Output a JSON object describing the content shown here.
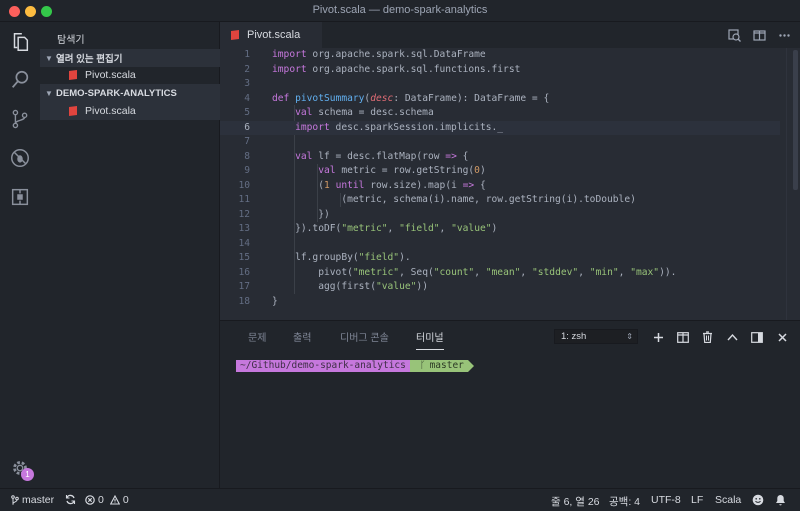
{
  "window": {
    "title": "Pivot.scala — demo-spark-analytics"
  },
  "activity": {
    "badge": "1"
  },
  "sidebar": {
    "title": "탐색기",
    "open_editors_label": "열려 있는 편집기",
    "open_file": "Pivot.scala",
    "project_label": "DEMO-SPARK-ANALYTICS",
    "project_file": "Pivot.scala"
  },
  "tab": {
    "label": "Pivot.scala"
  },
  "code": {
    "line_numbers": [
      "1",
      "2",
      "3",
      "4",
      "5",
      "6",
      "7",
      "8",
      "9",
      "10",
      "11",
      "12",
      "13",
      "14",
      "15",
      "16",
      "17",
      "18"
    ],
    "l1": [
      "import",
      " org.apache.spark.sql.DataFrame"
    ],
    "l2": [
      "import",
      " org.apache.spark.sql.functions.first"
    ],
    "l4": [
      "def",
      " ",
      "pivotSummary",
      "(",
      "desc",
      ": DataFrame): DataFrame = {"
    ],
    "l5": [
      "val",
      " schema = desc.schema"
    ],
    "l6": [
      "import",
      " desc.sparkSession.implicits._"
    ],
    "l8": [
      "val",
      " lf = desc.flatMap(row ",
      "=>",
      " {"
    ],
    "l9": [
      "val",
      " metric = row.getString(",
      "0",
      ")"
    ],
    "l10": [
      "(",
      "1",
      " ",
      "until",
      " row.size).map(i ",
      "=>",
      " {"
    ],
    "l11": [
      "(metric, schema(i).name, row.getString(i).toDouble)"
    ],
    "l12": [
      "})"
    ],
    "l13": [
      "}).toDF(",
      "\"metric\"",
      ", ",
      "\"field\"",
      ", ",
      "\"value\"",
      ")"
    ],
    "l15": [
      "lf.groupBy(",
      "\"field\"",
      ")."
    ],
    "l16": [
      "pivot(",
      "\"metric\"",
      ", Seq(",
      "\"count\"",
      ", ",
      "\"mean\"",
      ", ",
      "\"stddev\"",
      ", ",
      "\"min\"",
      ", ",
      "\"max\"",
      "))."
    ],
    "l17": [
      "agg(first(",
      "\"value\"",
      "))"
    ],
    "l18": [
      "}"
    ]
  },
  "panel": {
    "tabs": [
      "문제",
      "출력",
      "디버그 콘솔",
      "터미널"
    ],
    "active_tab": "터미널",
    "shell_select": "1: zsh",
    "prompt_path": "~/Github/demo-spark-analytics",
    "prompt_branch": "master"
  },
  "status": {
    "branch": "master",
    "errors": "0",
    "warnings": "0",
    "position": "줄 6, 열 26",
    "spaces": "공백: 4",
    "encoding": "UTF-8",
    "eol": "LF",
    "language": "Scala"
  },
  "colors": {
    "keyword": "#c678dd",
    "function": "#61afef",
    "string": "#98c379",
    "number": "#d19a66",
    "param": "#e06c75",
    "scala_icon": "#e0443e"
  },
  "icons": [
    "files-icon",
    "search-icon",
    "source-control-icon",
    "debug-icon",
    "extensions-icon",
    "settings-icon",
    "split-editor-icon",
    "open-changes-icon",
    "more-icon"
  ]
}
